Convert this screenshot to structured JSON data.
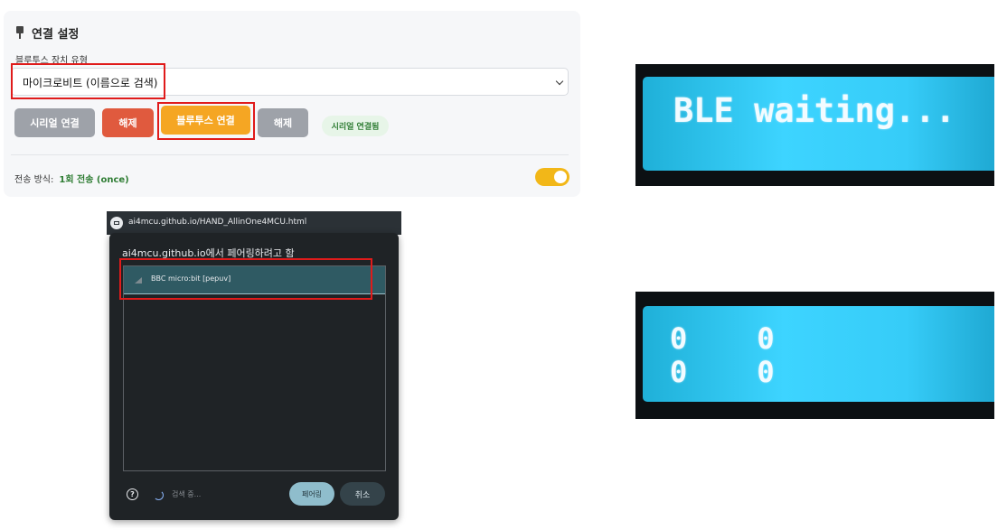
{
  "connection_panel": {
    "title": "연결 설정",
    "device_type_label": "블루투스 장치 유형",
    "device_type_value": "마이크로비트 (이름으로 검색)",
    "buttons": {
      "serial_connect": "시리얼 연결",
      "serial_disconnect": "해제",
      "bluetooth_connect": "블루투스 연결",
      "bluetooth_disconnect": "해제"
    },
    "status_badge": "시리얼 연결됨",
    "transfer_mode_label": "전송 방식:",
    "transfer_mode_value": "1회 전송 (once)",
    "transfer_toggle_on": true
  },
  "pairing_dialog": {
    "url": "ai4mcu.github.io/HAND_AllinOne4MCU.html",
    "title": "ai4mcu.github.io에서 페어링하려고 함",
    "devices": [
      "BBC micro:bit [pepuv]"
    ],
    "help_icon": "?",
    "searching_text": "검색 중...",
    "pair_button": "페어링",
    "cancel_button": "취소"
  },
  "lcd_top": {
    "line1": "BLE waiting..."
  },
  "lcd_bottom": {
    "line1": "0    0",
    "line2": "0    0"
  },
  "colors": {
    "highlight_box": "#e01b1b",
    "bluetooth_button": "#f5a623",
    "disconnect_button": "#e05a3e",
    "neutral_button": "#9ea2a9",
    "toggle_on": "#f2b718",
    "status_text": "#2f7d34",
    "lcd_backlight": "#3dd4ff"
  }
}
